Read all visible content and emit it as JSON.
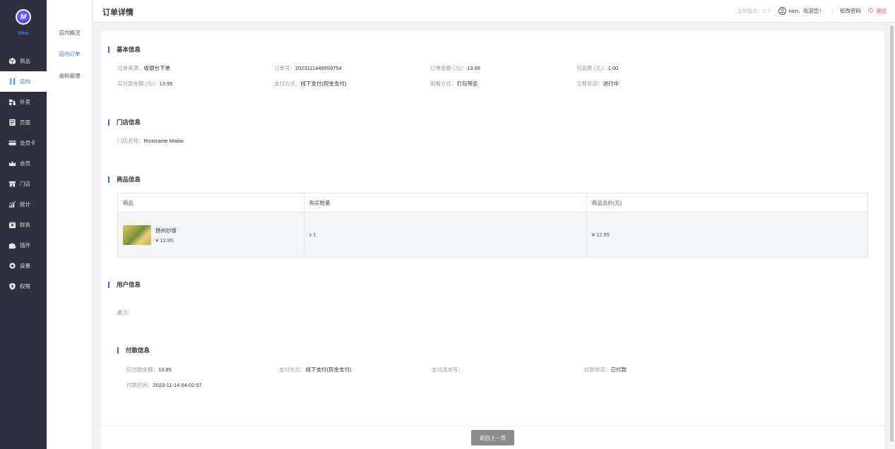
{
  "brand": {
    "logo_letter": "M",
    "name": "Mitai"
  },
  "nav": {
    "items": [
      {
        "label": "商品",
        "icon": "box-icon"
      },
      {
        "label": "店内",
        "icon": "cutlery-icon"
      },
      {
        "label": "外卖",
        "icon": "scooter-icon"
      },
      {
        "label": "页面",
        "icon": "page-icon"
      },
      {
        "label": "会员卡",
        "icon": "card-icon"
      },
      {
        "label": "会员",
        "icon": "crown-icon"
      },
      {
        "label": "门店",
        "icon": "store-icon"
      },
      {
        "label": "统计",
        "icon": "chart-icon"
      },
      {
        "label": "财务",
        "icon": "finance-icon"
      },
      {
        "label": "插件",
        "icon": "puzzle-icon"
      },
      {
        "label": "设置",
        "icon": "gear-icon"
      },
      {
        "label": "权限",
        "icon": "shield-icon"
      }
    ],
    "active_index": 1
  },
  "submenu": {
    "items": [
      "店内概况",
      "店内订单",
      "桌码管理"
    ],
    "active_index": 1
  },
  "header": {
    "title": "订单详情",
    "version": "当前版本：2.7",
    "welcome": "root，欢迎您！",
    "separator": "|",
    "change_password": "修改密码",
    "logout": "退出"
  },
  "basic_info": {
    "title": "基本信息",
    "source_label": "订单来源：",
    "source": "收银台下单",
    "order_no_label": "订单号：",
    "order_no": "2023111449559754",
    "amount_label": "订单金额 (元)：",
    "amount": "13.95",
    "packing_label": "包装费 (元)：",
    "packing": "1.00",
    "paid_label": "实付款金额 (元)：",
    "paid": "13.95",
    "pay_method_label": "支付方式：",
    "pay_method": "线下支付(现金支付)",
    "dining_label": "用餐方式：",
    "dining": "打包带走",
    "status_label": "交易状态：",
    "status": "进行中"
  },
  "store_info": {
    "title": "门店信息",
    "name_label": "门店名称：",
    "name": "Ristorante Maitai"
  },
  "product_info": {
    "title": "商品信息",
    "columns": [
      "商品",
      "购买数量",
      "商品总价(元)"
    ],
    "rows": [
      {
        "name": "扬州炒饭",
        "price": "¥ 12.95",
        "qty": "x 1",
        "total": "¥ 12.95"
      }
    ]
  },
  "user_info": {
    "title": "用户信息",
    "remark_label": "备注：",
    "remark": ""
  },
  "payment_info": {
    "title": "付款信息",
    "due_label": "应付款金额：",
    "due": "13.95",
    "method_label": "支付方式：",
    "method": "线下支付(现金支付)",
    "serial_label": "支付流水号：",
    "serial": "",
    "status_label": "付款状态：",
    "status": "已付款",
    "time_label": "付款时间：",
    "time": "2023-11-14 04:02:57"
  },
  "actions": {
    "back": "返回上一页"
  },
  "colors": {
    "accent": "#3f6fd8",
    "sidebar_bg": "#2f2f3f",
    "logout": "#e14545"
  }
}
